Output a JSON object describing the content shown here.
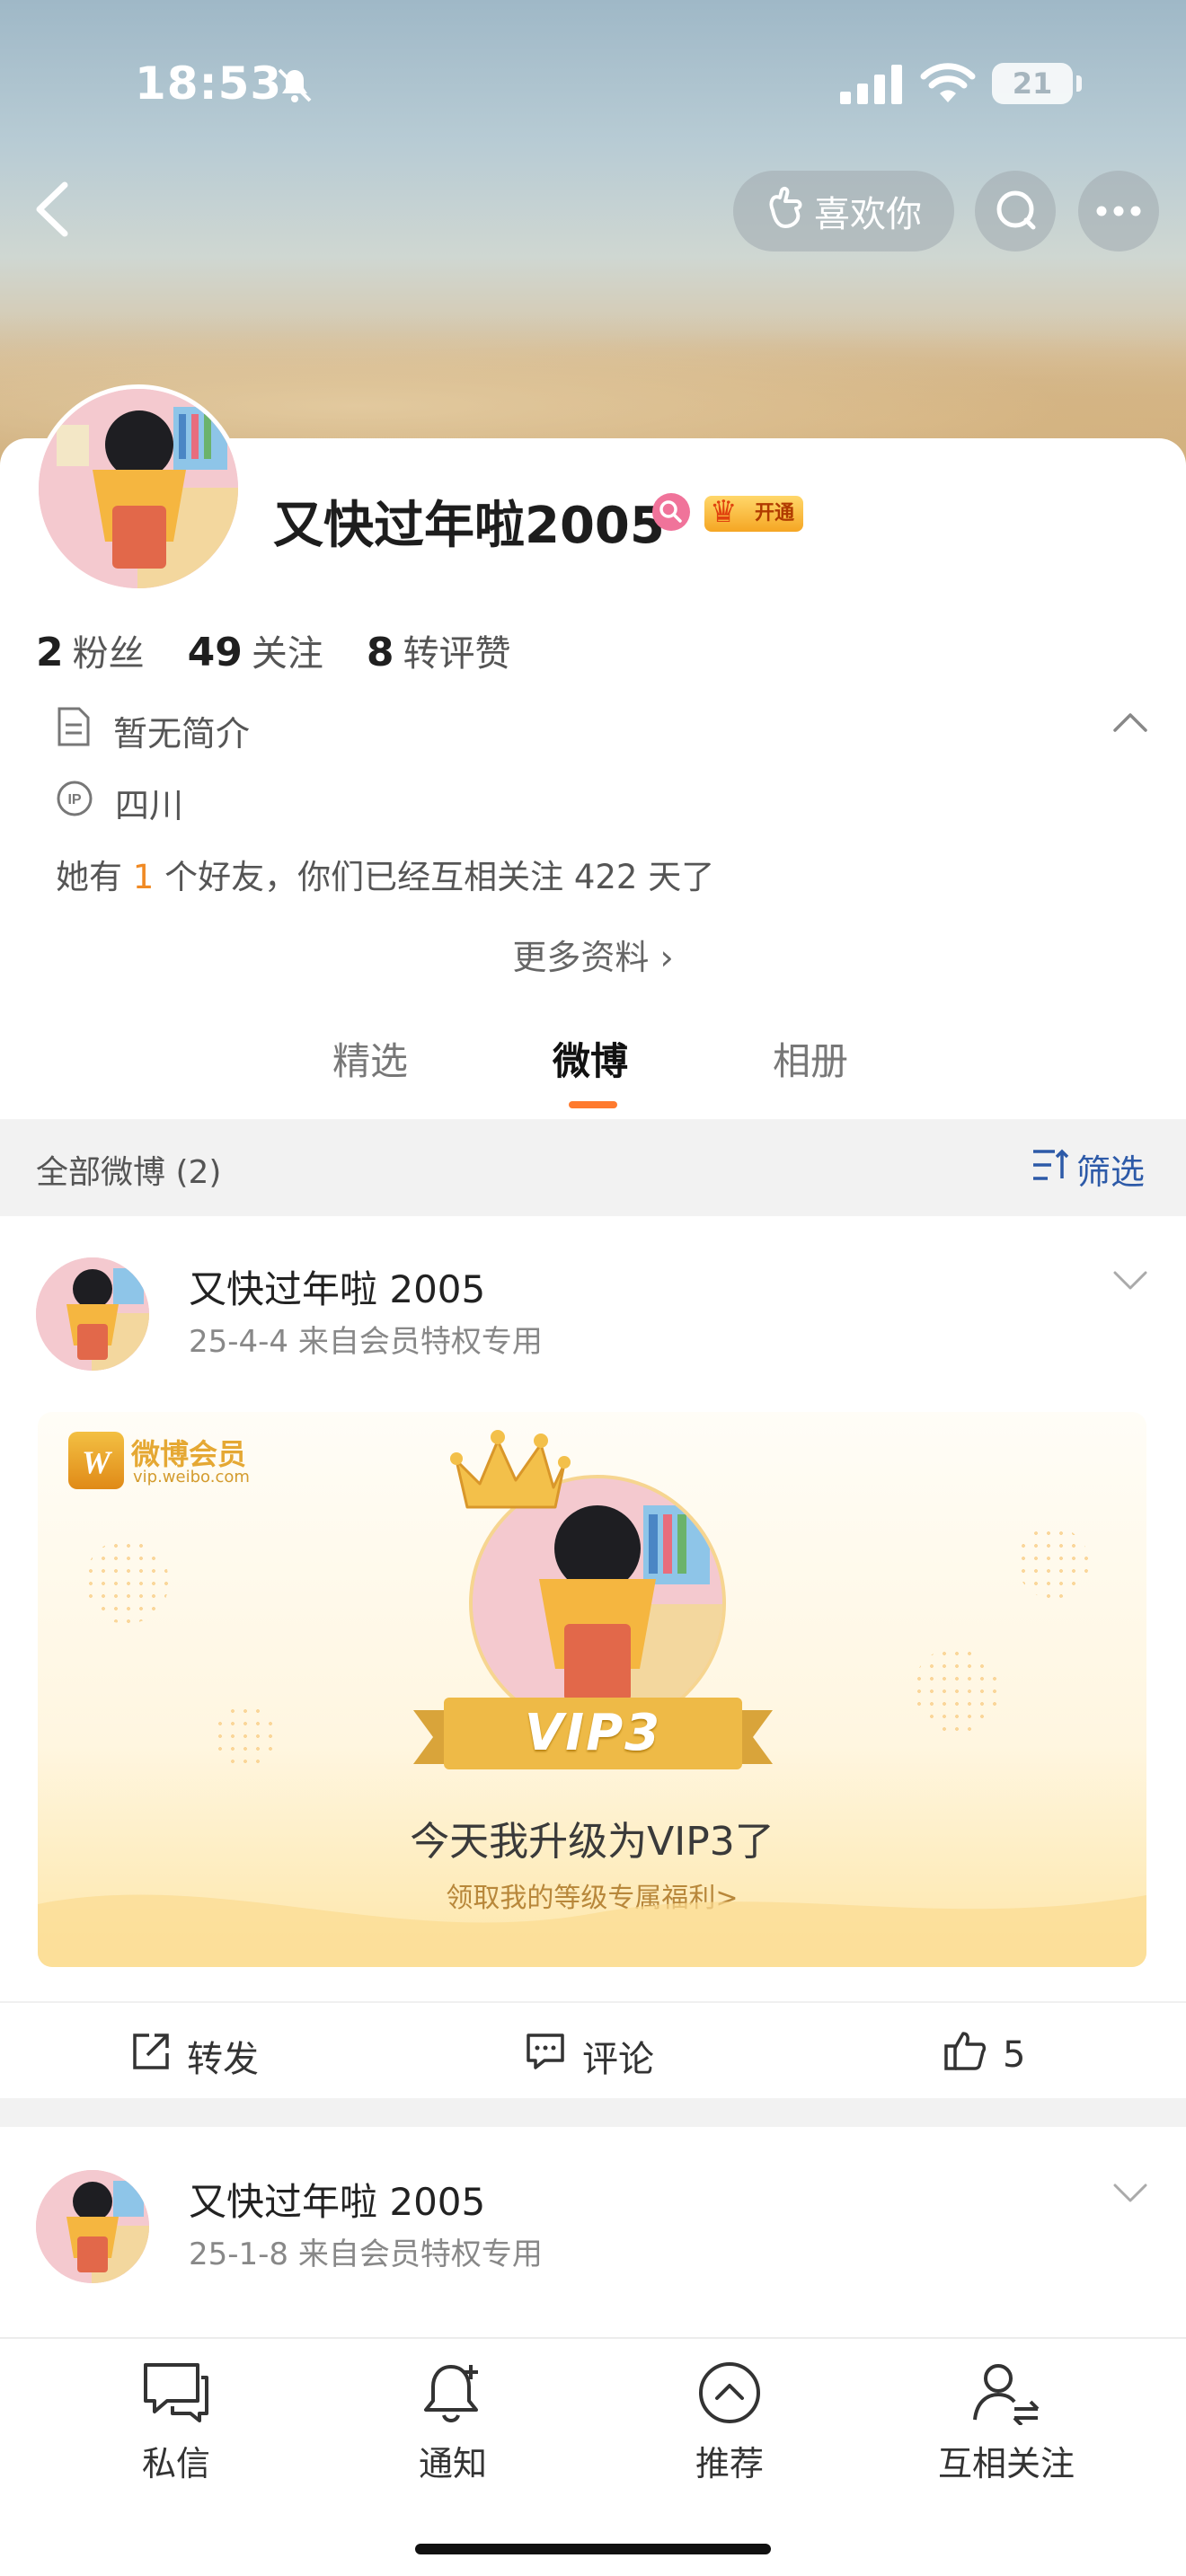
{
  "status_bar": {
    "time": "18:53",
    "battery": "21"
  },
  "nav": {
    "like_label": "喜欢你"
  },
  "profile": {
    "name": "又快过年啦2005",
    "vip_badge": "开通",
    "stats": [
      {
        "value": "2",
        "label": "粉丝"
      },
      {
        "value": "49",
        "label": "关注"
      },
      {
        "value": "8",
        "label": "转评赞"
      }
    ],
    "bio": "暂无简介",
    "location": "四川",
    "friends_prefix": "她有",
    "friends_count": "1",
    "friends_suffix": "个好友，你们已经互相关注 422 天了",
    "more_info": "更多资料 ›"
  },
  "tabs": [
    {
      "label": "精选"
    },
    {
      "label": "微博"
    },
    {
      "label": "相册"
    }
  ],
  "filter_bar": {
    "all_label": "全部微博 (2)",
    "filter_label": "筛选"
  },
  "posts": [
    {
      "author": "又快过年啦 2005",
      "meta": "25-4-4  来自会员特权专用",
      "card": {
        "brand": "微博会员",
        "brand_url": "vip.weibo.com",
        "level": "VIP3",
        "headline": "今天我升级为VIP3了",
        "subline": "领取我的等级专属福利>"
      },
      "actions": {
        "repost": "转发",
        "comment": "评论",
        "like_count": "5"
      }
    },
    {
      "author": "又快过年啦 2005",
      "meta": "25-1-8  来自会员特权专用"
    }
  ],
  "bottom_bar": [
    {
      "label": "私信",
      "icon": "chat-icon"
    },
    {
      "label": "通知",
      "icon": "bell-icon"
    },
    {
      "label": "推荐",
      "icon": "up-circle-icon"
    },
    {
      "label": "互相关注",
      "icon": "mutual-follow-icon"
    }
  ],
  "colors": {
    "accent": "#ff7a2e",
    "link": "#2d5aa8",
    "highlight": "#f08a24"
  }
}
